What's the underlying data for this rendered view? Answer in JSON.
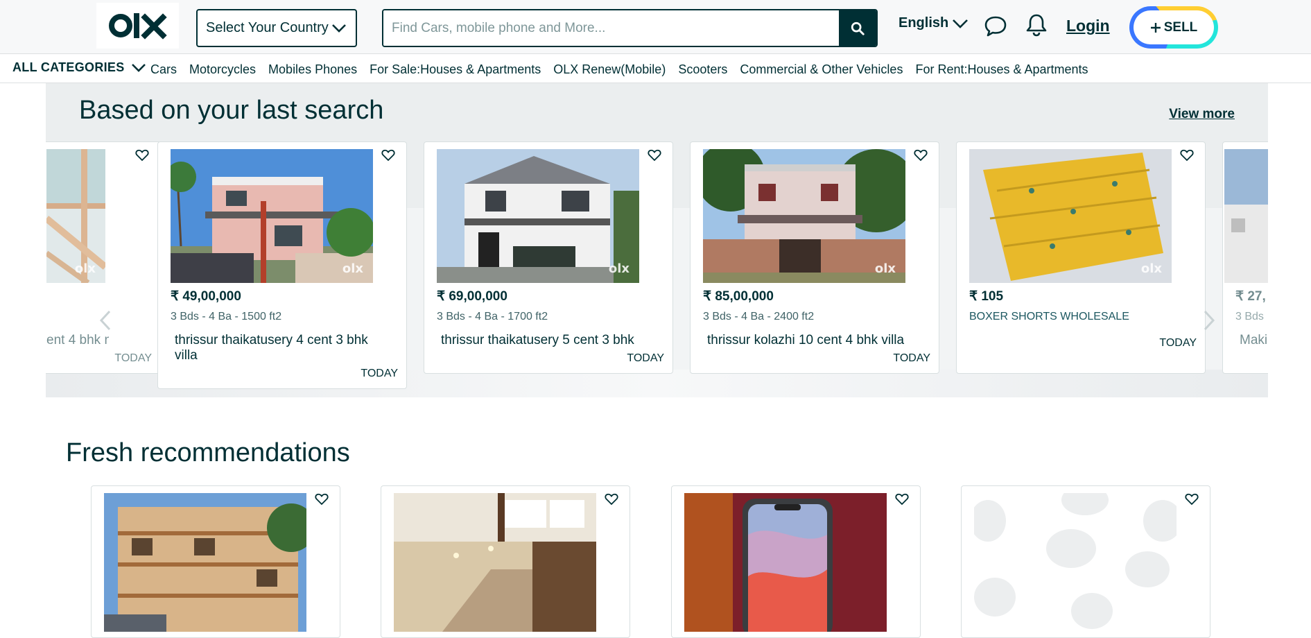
{
  "header": {
    "logo_text": "olx",
    "country_select": "Select Your Country",
    "search_placeholder": "Find Cars, mobile phone and More...",
    "language": "English",
    "login": "Login",
    "sell": "SELL",
    "icons": [
      "search-icon",
      "chat-icon",
      "bell-icon",
      "plus-icon",
      "chevron-down-icon"
    ]
  },
  "categories": {
    "all_label": "ALL CATEGORIES",
    "links": [
      "Cars",
      "Motorcycles",
      "Mobiles Phones",
      "For Sale:Houses & Apartments",
      "OLX Renew(Mobile)",
      "Scooters",
      "Commercial & Other Vehicles",
      "For Rent:Houses & Apartments"
    ]
  },
  "last_search": {
    "title": "Based on your last search",
    "view_more": "View more",
    "partial_left": {
      "title": "ent 4 bhk n",
      "date": "TODAY"
    },
    "cards": [
      {
        "price": "₹ 49,00,000",
        "spec": "3 Bds - 4 Ba - 1500 ft2",
        "title": "thrissur thaikatusery 4 cent 3 bhk villa",
        "date": "TODAY"
      },
      {
        "price": "₹ 69,00,000",
        "spec": "3 Bds - 4 Ba - 1700 ft2",
        "title": "thrissur thaikatusery 5 cent 3 bhk",
        "date": "TODAY"
      },
      {
        "price": "₹ 85,00,000",
        "spec": "3 Bds - 4 Ba - 2400 ft2",
        "title": "thrissur kolazhi 10 cent 4 bhk villa",
        "date": "TODAY"
      },
      {
        "price": "₹ 105",
        "spec": "BOXER SHORTS WHOLESALE",
        "title": "",
        "date": "TODAY"
      }
    ],
    "partial_right": {
      "price": "₹ 27,",
      "spec": "3 Bds",
      "title": "Maki"
    }
  },
  "fresh": {
    "title": "Fresh recommendations"
  },
  "colors": {
    "primary": "#002f34",
    "accent_blue": "#3a77ff",
    "accent_yellow": "#ffce32",
    "accent_teal": "#23e5db"
  }
}
